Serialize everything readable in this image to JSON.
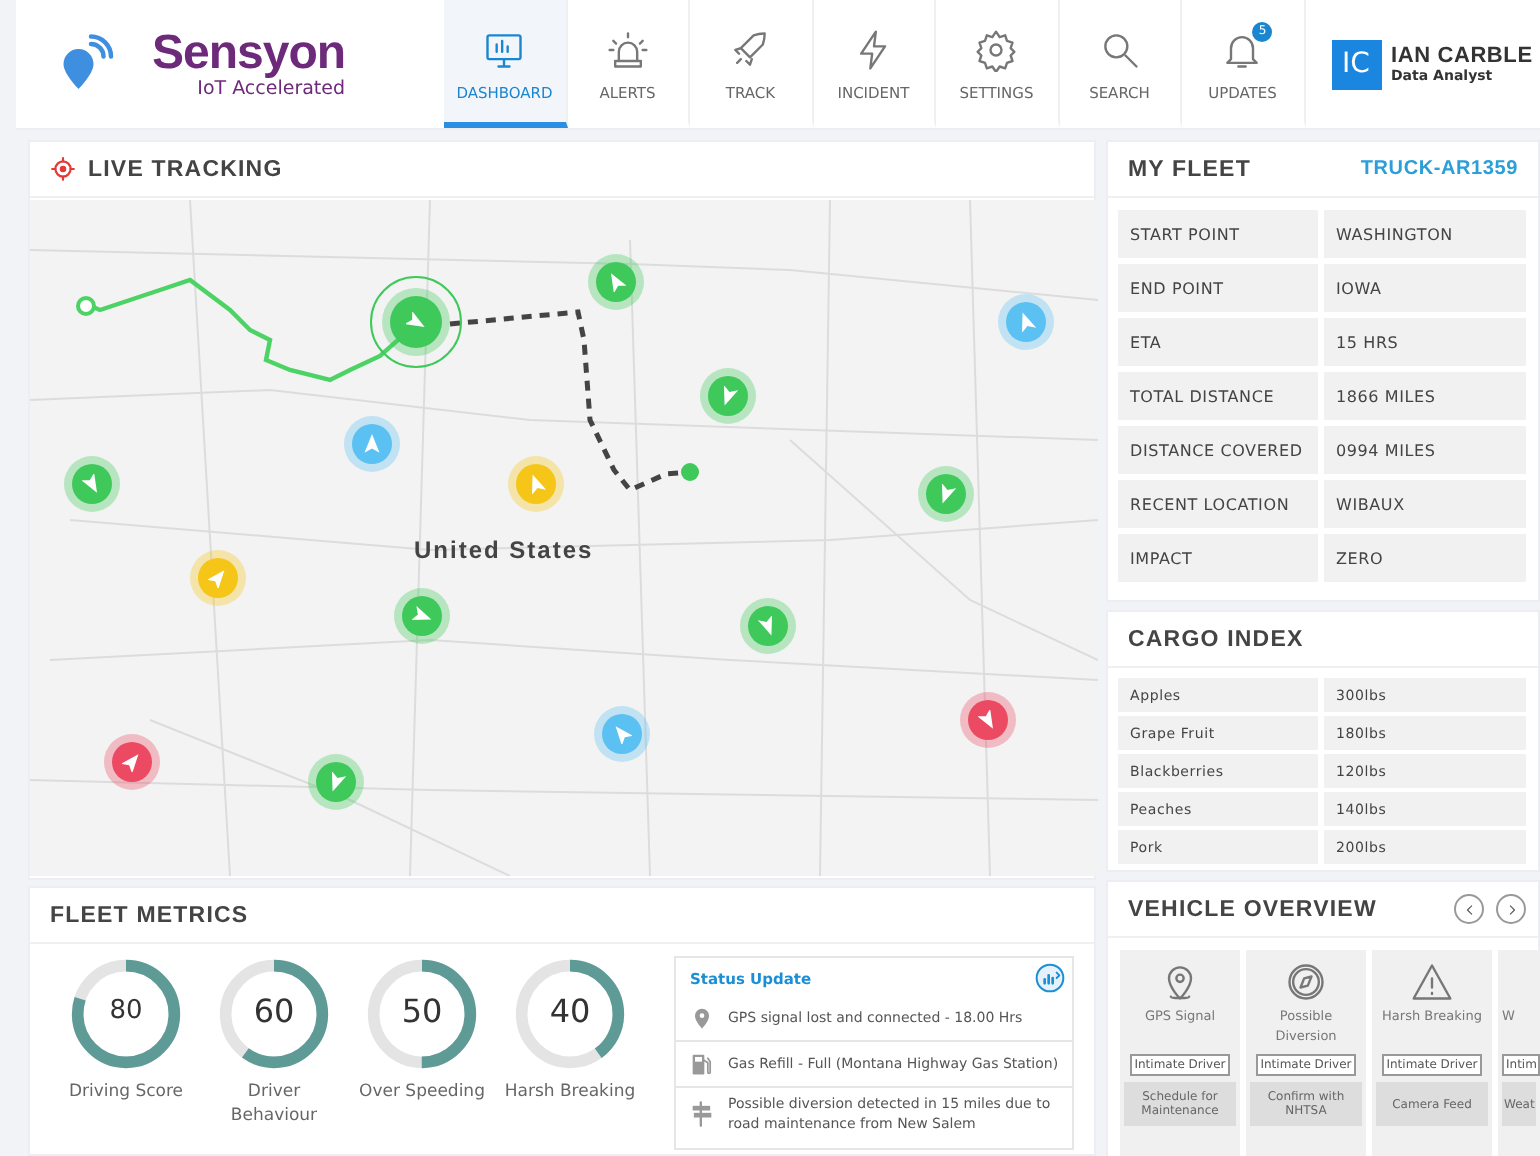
{
  "brand": {
    "name": "Sensyon",
    "tagline": "IoT Accelerated"
  },
  "nav": [
    {
      "label": "DASHBOARD",
      "kind": "monitor",
      "selected": true
    },
    {
      "label": "ALERTS",
      "kind": "siren",
      "selected": false
    },
    {
      "label": "TRACK",
      "kind": "rocket",
      "selected": false
    },
    {
      "label": "INCIDENT",
      "kind": "bolt",
      "selected": false
    },
    {
      "label": "SETTINGS",
      "kind": "gear",
      "selected": false
    },
    {
      "label": "SEARCH",
      "kind": "search",
      "selected": false
    },
    {
      "label": "UPDATES",
      "kind": "bell",
      "selected": false,
      "badge": "5"
    }
  ],
  "user": {
    "initials": "IC",
    "name": "IAN CARBLE",
    "role": "Data Analyst"
  },
  "live_tracking": {
    "title": "LIVE TRACKING",
    "map_label": "United States",
    "markers": [
      {
        "color": "#3ec95a",
        "selected": true
      },
      {
        "color": "#3ec95a",
        "selected": false
      },
      {
        "color": "#5bc0f2",
        "selected": false
      },
      {
        "color": "#3ec95a",
        "selected": false
      },
      {
        "color": "#5bc0f2",
        "selected": false
      },
      {
        "color": "#f5c518",
        "selected": false
      },
      {
        "color": "#3ec95a",
        "selected": false
      },
      {
        "color": "#3ec95a",
        "selected": false
      },
      {
        "color": "#f5c518",
        "selected": false
      },
      {
        "color": "#3ec95a",
        "selected": false
      },
      {
        "color": "#3ec95a",
        "selected": false
      },
      {
        "color": "#5bc0f2",
        "selected": false
      },
      {
        "color": "#ec4a63",
        "selected": false
      },
      {
        "color": "#ec4a63",
        "selected": false
      },
      {
        "color": "#3ec95a",
        "selected": false
      }
    ]
  },
  "my_fleet": {
    "title": "MY FLEET",
    "truck": "TRUCK-AR1359",
    "rows": [
      {
        "label": "START POINT",
        "value": "WASHINGTON"
      },
      {
        "label": "END POINT",
        "value": "IOWA"
      },
      {
        "label": "ETA",
        "value": "15 HRS"
      },
      {
        "label": "TOTAL DISTANCE",
        "value": "1866 MILES"
      },
      {
        "label": "DISTANCE COVERED",
        "value": "0994 MILES"
      },
      {
        "label": "RECENT LOCATION",
        "value": "WIBAUX"
      },
      {
        "label": "IMPACT",
        "value": "ZERO"
      }
    ]
  },
  "cargo_index": {
    "title": "CARGO INDEX",
    "rows": [
      {
        "item": "Apples",
        "weight": "300lbs"
      },
      {
        "item": "Grape Fruit",
        "weight": "180lbs"
      },
      {
        "item": "Blackberries",
        "weight": "120lbs"
      },
      {
        "item": "Peaches",
        "weight": "140lbs"
      },
      {
        "item": "Pork",
        "weight": "200lbs"
      }
    ]
  },
  "fleet_metrics": {
    "title": "FLEET METRICS",
    "gauges": [
      {
        "value": "80",
        "label": "Driving Score",
        "level": 0.8
      },
      {
        "value": "60",
        "label": "Driver Behaviour",
        "level": 0.6
      },
      {
        "value": "50",
        "label": "Over Speeding",
        "level": 0.5
      },
      {
        "value": "40",
        "label": "Harsh Breaking",
        "level": 0.4
      }
    ],
    "status_update": {
      "title": "Status Update",
      "items": [
        {
          "kind": "location",
          "text": "GPS signal lost and connected - 18.00 Hrs"
        },
        {
          "kind": "fuel",
          "text": "Gas Refill - Full (Montana Highway Gas Station)"
        },
        {
          "kind": "signpost",
          "text": "Possible diversion detected in 15 miles due to road maintenance from New Salem"
        }
      ]
    }
  },
  "vehicle_overview": {
    "title": "VEHICLE OVERVIEW",
    "cards": [
      {
        "kind": "pin",
        "label": "GPS Signal",
        "primary": "Intimate Driver",
        "secondary": "Schedule for Maintenance"
      },
      {
        "kind": "compass",
        "label": "Possible Diversion",
        "primary": "Intimate Driver",
        "secondary": "Confirm with NHTSA"
      },
      {
        "kind": "warning",
        "label": "Harsh Breaking",
        "primary": "Intimate Driver",
        "secondary": "Camera Feed"
      },
      {
        "kind": "cut",
        "label": "W",
        "primary": "Intim",
        "secondary": "Weat"
      }
    ]
  }
}
